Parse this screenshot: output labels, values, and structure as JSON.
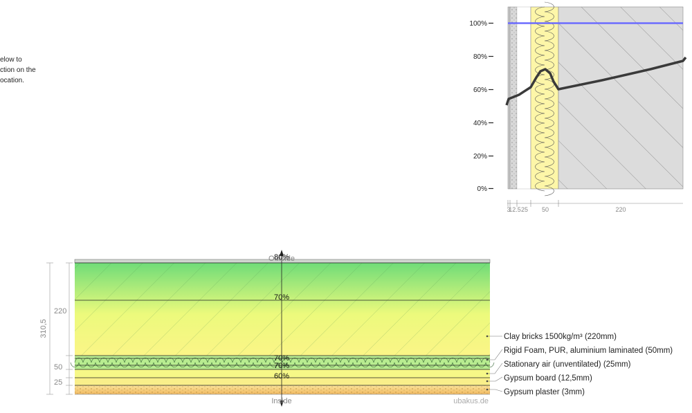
{
  "intro_text": [
    "elow to",
    "ction on the",
    "ocation."
  ],
  "rh_chart": {
    "y_ticks": [
      "100%",
      "80%",
      "60%",
      "40%",
      "20%",
      "0%"
    ],
    "dimension_labels": [
      "3",
      "12.5",
      "25",
      "50",
      "220"
    ]
  },
  "section": {
    "outside_label": "Outside",
    "inside_label": "Inside",
    "watermark": "ubakus.de",
    "total_dimension": "310,5",
    "dimensions": [
      "220",
      "50",
      "25"
    ],
    "humidity_labels": [
      "80%",
      "70%",
      "70%",
      "70%",
      "60%"
    ],
    "layers": [
      "Clay bricks 1500kg/m³ (220mm)",
      "Rigid Foam, PUR, aluminium laminated (50mm)",
      "Stationary air (unventilated) (25mm)",
      "Gypsum board (12,5mm)",
      "Gypsum plaster (3mm)"
    ]
  },
  "colors": {
    "brick_hatch": "#dcdcdc",
    "insulation": "#fdf6a8",
    "line_100": "#6b6bff",
    "humidity_line": "#3a3a3a",
    "green_top": "#7de07d",
    "yellow_bottom": "#f8f880",
    "plaster": "#f0c070"
  }
}
